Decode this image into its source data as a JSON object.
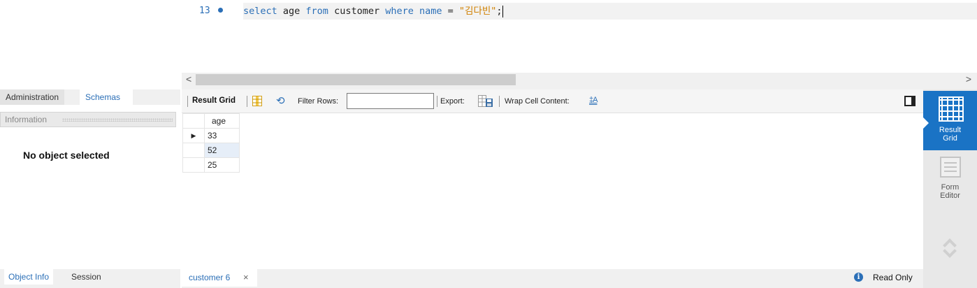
{
  "sidebar": {
    "tabs": [
      "Administration",
      "Schemas"
    ],
    "info_title": "Information",
    "no_object_text": "No object selected",
    "bottom_tabs": [
      "Object Info",
      "Session"
    ]
  },
  "editor": {
    "line_number": "13",
    "code": {
      "kw_select": "select",
      "col": " age ",
      "kw_from": "from",
      "table": " customer ",
      "kw_where": "where",
      "kw_name": " name",
      "op": " = ",
      "string": "\"김다빈\"",
      "end": ";"
    }
  },
  "toolbar": {
    "result_grid": "Result Grid",
    "filter_rows": "Filter Rows:",
    "filter_value": "",
    "export": "Export:",
    "wrap_cell": "Wrap Cell Content:",
    "wrap_icon": "‡A"
  },
  "grid": {
    "column": "age",
    "rows": [
      "33",
      "52",
      "25"
    ],
    "current_row_marker": "▶"
  },
  "right_panel": {
    "result_grid_label": "Result\nGrid",
    "form_editor_label": "Form\nEditor"
  },
  "status": {
    "query_tab": "customer 6",
    "close_glyph": "×",
    "info_glyph": "i",
    "read_only": "Read Only"
  },
  "scroll": {
    "left_glyph": "<",
    "right_glyph": ">"
  },
  "colors": {
    "accent": "#1a73c5",
    "keyword": "#2b6fb7",
    "string": "#d08000"
  }
}
